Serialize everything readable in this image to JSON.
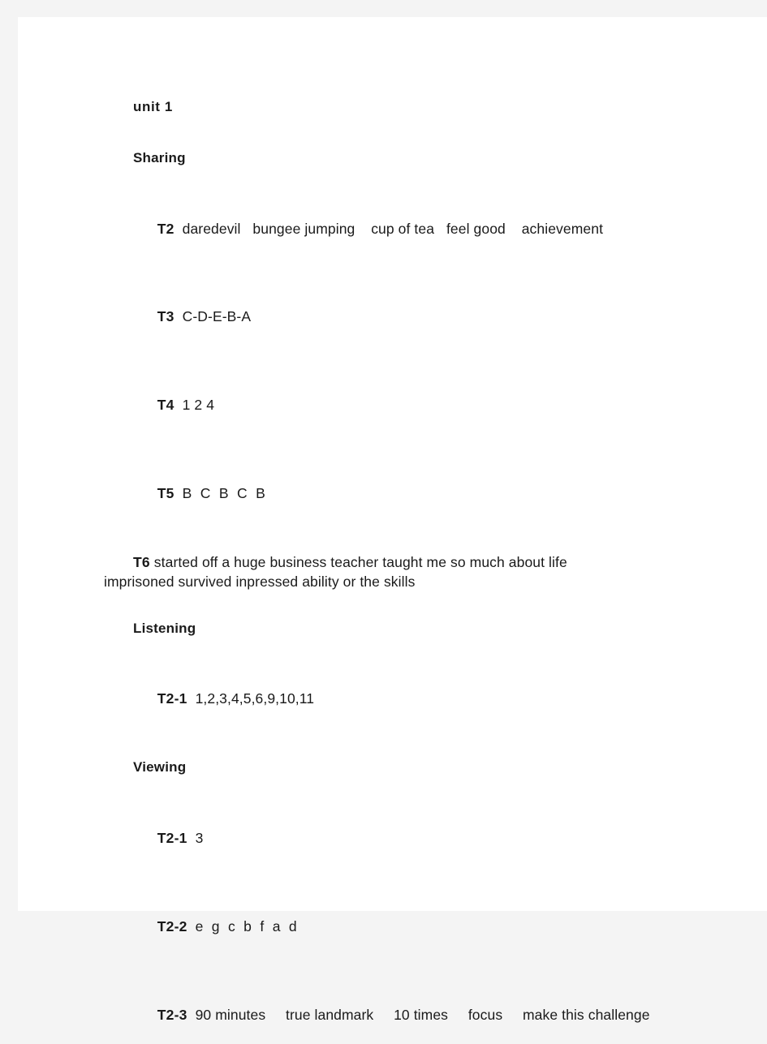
{
  "document": {
    "unit_title": "unit 1",
    "sections": [
      {
        "heading": "Sharing",
        "items": [
          {
            "label": "T2",
            "answer": "daredevil   bungee jumping    cup of tea   feel good    achievement"
          },
          {
            "label": "T3",
            "answer": "C-D-E-B-A"
          },
          {
            "label": "T4",
            "answer": "1 2 4"
          },
          {
            "label": "T5",
            "answer": "B C B C B"
          }
        ],
        "paragraph": {
          "label": "T6",
          "line1": "started off    a huge business    teacher    taught me so much      about life",
          "line2": "imprisoned    survived    inpressed    ability or the skills"
        }
      },
      {
        "heading": "Listening",
        "items": [
          {
            "label": "T2-1",
            "answer": "1,2,3,4,5,6,9,10,11"
          }
        ]
      },
      {
        "heading": "Viewing",
        "items": [
          {
            "label": "T2-1",
            "answer": "3"
          },
          {
            "label": "T2-2",
            "answer": "e g c b f a d"
          },
          {
            "label": "T2-3",
            "answer": "90 minutes     true landmark     10 times     focus     make this challenge"
          }
        ]
      }
    ]
  },
  "colors": {
    "page_background": "#ffffff",
    "canvas_background": "#f4f4f4",
    "text": "#1a1a1a"
  }
}
